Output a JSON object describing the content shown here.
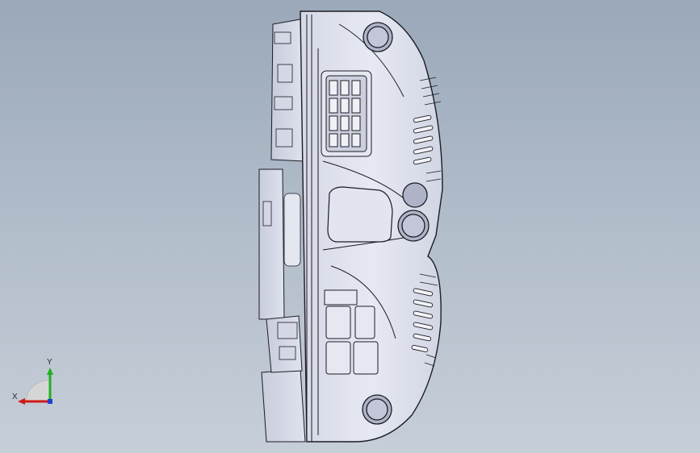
{
  "viewport": {
    "background_top": "#9aa8b9",
    "background_bottom": "#c6ced8",
    "model_fill": "#dfe2ee",
    "model_stroke": "#1c1c24",
    "hole_fill": "#aeb3c8"
  },
  "triad": {
    "x_label": "X",
    "y_label": "Y",
    "x_color": "#d01818",
    "y_color": "#20b020",
    "z_color": "#2040d0"
  }
}
